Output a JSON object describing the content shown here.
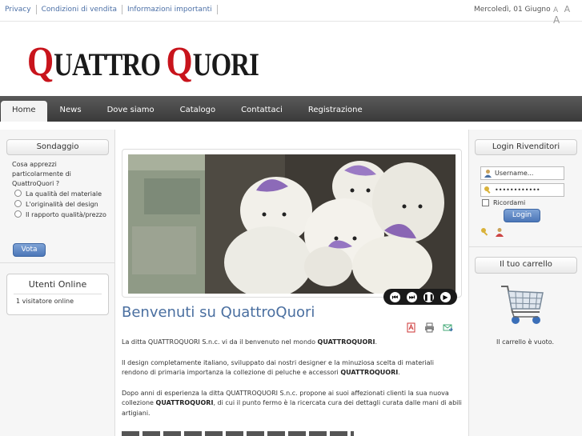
{
  "topbar": {
    "links": [
      "Privacy",
      "Condizioni di vendita",
      "Informazioni importanti"
    ],
    "date": "Mercoledì, 01 Giugno",
    "font_sizes": [
      "A",
      "A",
      "A"
    ]
  },
  "logo": {
    "q1": "Q",
    "w1": "UATTRO ",
    "q2": "Q",
    "w2": "UORI"
  },
  "nav": {
    "items": [
      "Home",
      "News",
      "Dove siamo",
      "Catalogo",
      "Contattaci",
      "Registrazione"
    ],
    "active": "Home"
  },
  "poll": {
    "title": "Sondaggio",
    "question": "Cosa apprezzi particolarmente di QuattroQuori ?",
    "options": [
      "La qualità del materiale",
      "L'originalità del design",
      "Il rapporto qualità/prezzo"
    ],
    "vote_label": "Vota"
  },
  "online": {
    "title": "Utenti Online",
    "text": "1 visitatore online"
  },
  "main": {
    "title": "Benvenuti su QuattroQuori",
    "p1_a": "La ditta QUATTROQUORI S.n.c. vi da il benvenuto nel mondo ",
    "p1_b": "QUATTROQUORI",
    "p1_c": ".",
    "p2_a": "Il design completamente italiano, sviluppato dai nostri designer e la minuziosa scelta di materiali rendono di primaria importanza la collezione di peluche e accessori ",
    "p2_b": "QUATTROQUORI",
    "p2_c": ".",
    "p3_a": "Dopo anni di esperienza la ditta QUATTROQUORI S.n.c. propone ai suoi affezionati clienti la sua nuova collezione ",
    "p3_b": "QUATTROQUORI",
    "p3_c": ", di cui il punto fermo è la ricercata cura dei dettagli curata dalle mani di abili artigiani."
  },
  "slideshow": {
    "controls": [
      "first-icon",
      "last-icon",
      "pause-icon",
      "next-icon"
    ]
  },
  "login": {
    "title": "Login Rivenditori",
    "username_placeholder": "Username...",
    "password_value": "••••••••••••",
    "remember_label": "Ricordami",
    "login_label": "Login"
  },
  "cart": {
    "title": "Il tuo carrello",
    "empty_text": "Il carrello è vuoto."
  },
  "colors": {
    "brand_red": "#c8141c",
    "link_blue": "#4b6fa6",
    "button_blue": "#4c77b8"
  }
}
